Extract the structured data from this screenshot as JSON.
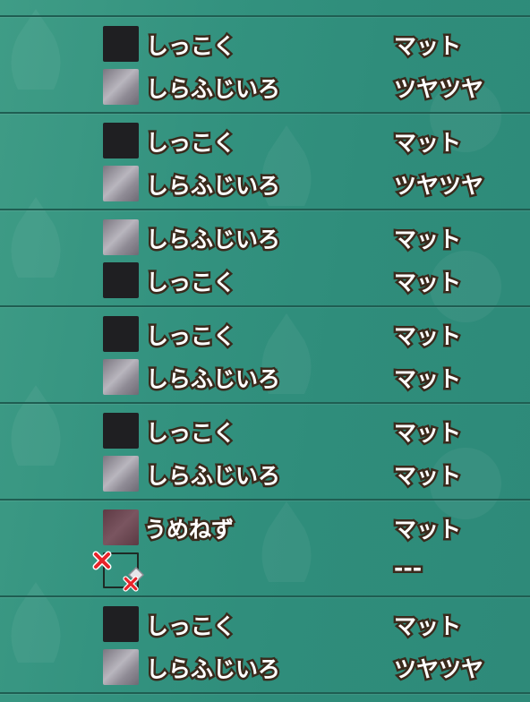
{
  "groups": [
    {
      "rows": [
        {
          "color": "しっこく",
          "finish": "マット",
          "swatch": "shikkoku"
        },
        {
          "color": "しらふじいろ",
          "finish": "ツヤツヤ",
          "swatch": "shirafuji"
        }
      ]
    },
    {
      "rows": [
        {
          "color": "しっこく",
          "finish": "マット",
          "swatch": "shikkoku"
        },
        {
          "color": "しらふじいろ",
          "finish": "ツヤツヤ",
          "swatch": "shirafuji"
        }
      ]
    },
    {
      "rows": [
        {
          "color": "しらふじいろ",
          "finish": "マット",
          "swatch": "shirafuji"
        },
        {
          "color": "しっこく",
          "finish": "マット",
          "swatch": "shikkoku"
        }
      ]
    },
    {
      "rows": [
        {
          "color": "しっこく",
          "finish": "マット",
          "swatch": "shikkoku"
        },
        {
          "color": "しらふじいろ",
          "finish": "マット",
          "swatch": "shirafuji"
        }
      ]
    },
    {
      "rows": [
        {
          "color": "しっこく",
          "finish": "マット",
          "swatch": "shikkoku"
        },
        {
          "color": "しらふじいろ",
          "finish": "マット",
          "swatch": "shirafuji"
        }
      ]
    },
    {
      "rows": [
        {
          "color": "うめねず",
          "finish": "マット",
          "swatch": "umenezu"
        },
        {
          "color": "",
          "finish": "---",
          "swatch": "empty"
        }
      ]
    },
    {
      "rows": [
        {
          "color": "しっこく",
          "finish": "マット",
          "swatch": "shikkoku"
        },
        {
          "color": "しらふじいろ",
          "finish": "ツヤツヤ",
          "swatch": "shirafuji"
        }
      ]
    }
  ],
  "colors": {
    "background": "#33927f",
    "divider": "#1f5e52",
    "shikkoku": "#1f1f22",
    "shirafuji": "#b9b6be",
    "umenezu": "#6a4550",
    "text": "#ffffff",
    "text_outline": "#3a2a1c",
    "remove_mark": "#e8232a"
  },
  "icons": {
    "empty_slot_marks": [
      "red-x-icon",
      "red-x-icon",
      "silver-diamond-icon"
    ]
  }
}
